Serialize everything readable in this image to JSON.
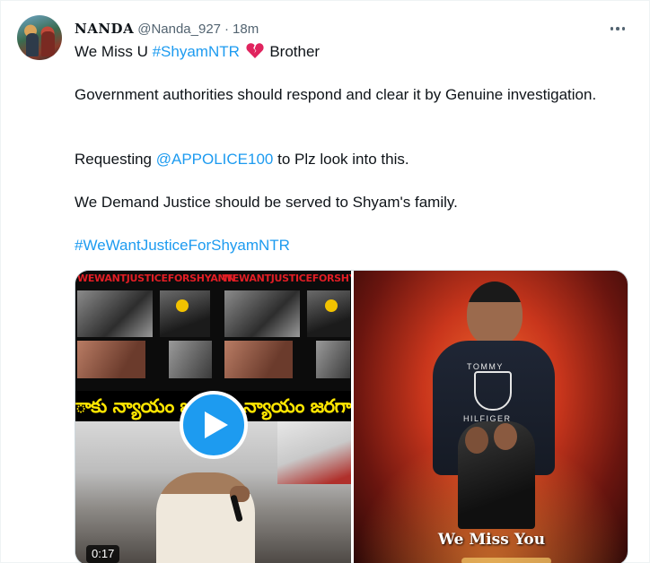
{
  "tweet": {
    "display_name": "NANDA",
    "handle": "@Nanda_927",
    "separator": "·",
    "time": "18m",
    "lines": {
      "line1_pre": "We Miss U ",
      "line1_hashtag": "#ShyamNTR",
      "line1_post": " Brother",
      "line2": "Government authorities should respond and clear it by Genuine investigation.",
      "line3_pre": "Requesting ",
      "line3_mention": "@APPOLICE100",
      "line3_post": " to Plz look into this.",
      "line4": "We Demand Justice should be served to Shyam's family.",
      "line5_hashtag": "#WeWantJusticeForShyamNTR"
    },
    "media": {
      "video": {
        "banner_left": "WEWANTJUSTICEFORSHYAMN",
        "banner_right": "WEWANTJUSTICEFORSHYAMN",
        "telugu_text": "ాకు న్యాయం జరగాకు న్యాయం జరగా",
        "duration": "0:17"
      },
      "image": {
        "brand_top": "TOMMY",
        "brand_bottom": "HILFIGER",
        "caption": "We Miss You"
      }
    }
  },
  "icons": {
    "more": "more-horizontal-icon",
    "heart": "broken-heart-icon",
    "play": "play-icon"
  },
  "colors": {
    "link": "#1d9bf0",
    "text": "#0f1419",
    "secondary": "#536471",
    "play_button": "#1d9bf0",
    "broken_heart": "#e0245e"
  }
}
